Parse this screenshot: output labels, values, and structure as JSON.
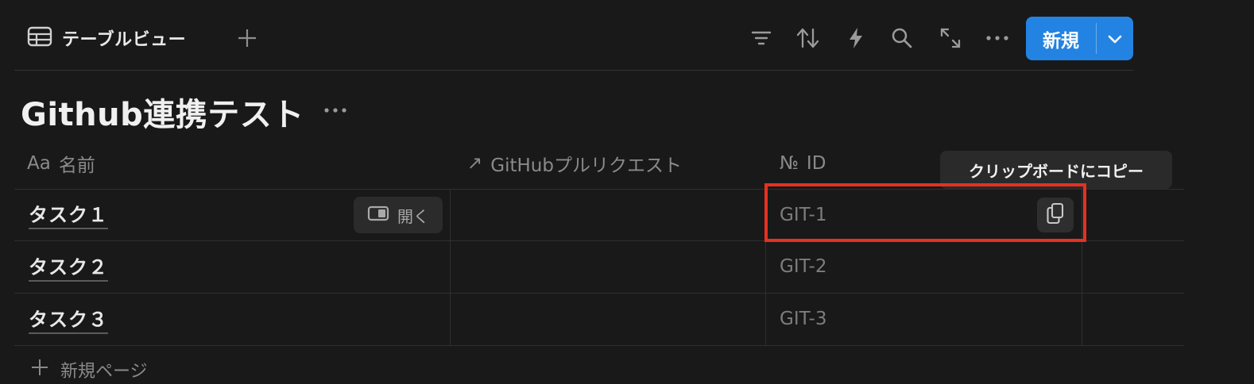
{
  "toolbar": {
    "view_name": "テーブルビュー",
    "new_button": "新規",
    "icons": [
      "filter-icon",
      "sort-icon",
      "automation-icon",
      "search-icon",
      "expand-icon",
      "more-icon"
    ]
  },
  "page": {
    "title": "Github連携テスト"
  },
  "table": {
    "columns": [
      {
        "icon": "Aa",
        "label": "名前"
      },
      {
        "icon": "↗",
        "label": "GitHubプルリクエスト"
      },
      {
        "icon": "№",
        "label": "ID"
      }
    ],
    "rows": [
      {
        "name": "タスク１",
        "pr": "",
        "id": "GIT-1"
      },
      {
        "name": "タスク２",
        "pr": "",
        "id": "GIT-2"
      },
      {
        "name": "タスク３",
        "pr": "",
        "id": "GIT-3"
      }
    ],
    "open_label": "開く",
    "new_page_label": "新規ページ"
  },
  "tooltip": {
    "text": "クリップボードにコピー"
  },
  "colors": {
    "background": "#191919",
    "accent": "#2383e2",
    "highlight": "#e63121"
  }
}
